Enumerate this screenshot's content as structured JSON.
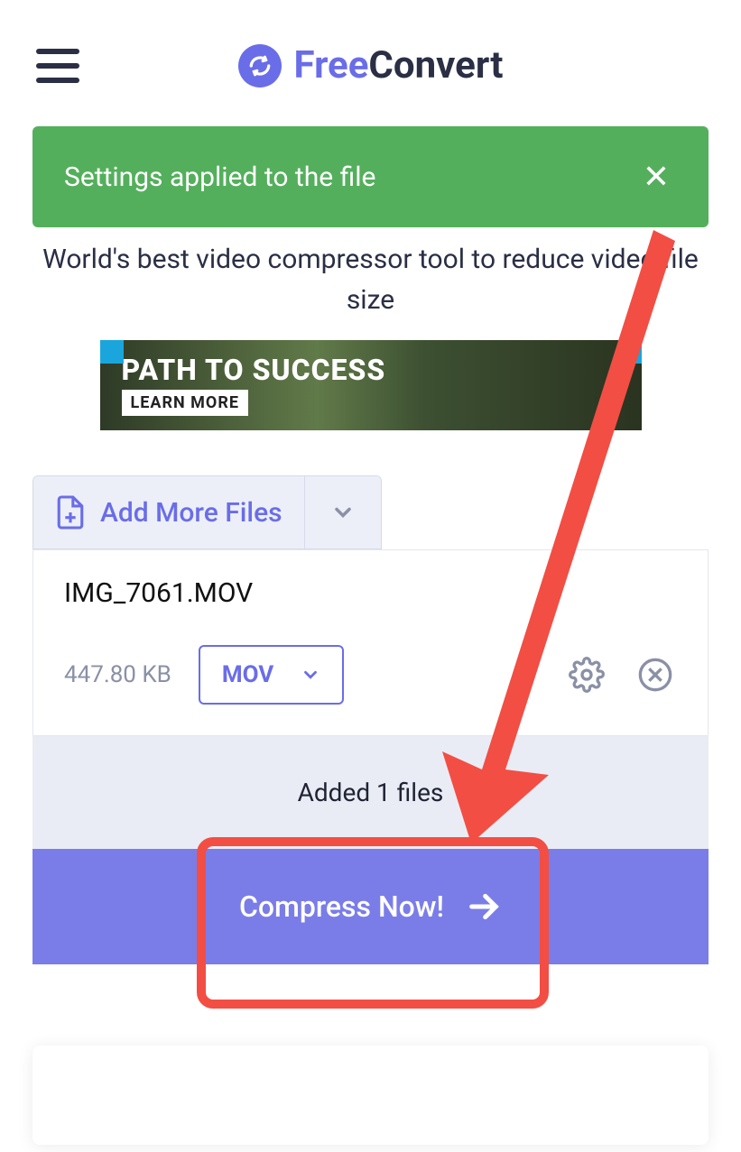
{
  "header": {
    "logo_free": "Free",
    "logo_convert": "Convert"
  },
  "toast": {
    "message": "Settings applied to the file",
    "close_glyph": "✕"
  },
  "tagline": "World's best video compressor tool to reduce video file size",
  "ad": {
    "title": "PATH TO SUCCESS",
    "cta": "LEARN MORE"
  },
  "toolbar": {
    "add_more_label": "Add More Files"
  },
  "file": {
    "name": "IMG_7061.MOV",
    "size": "447.80 KB",
    "format": "MOV"
  },
  "status": {
    "added_text": "Added 1 files"
  },
  "actions": {
    "compress_label": "Compress Now!"
  }
}
